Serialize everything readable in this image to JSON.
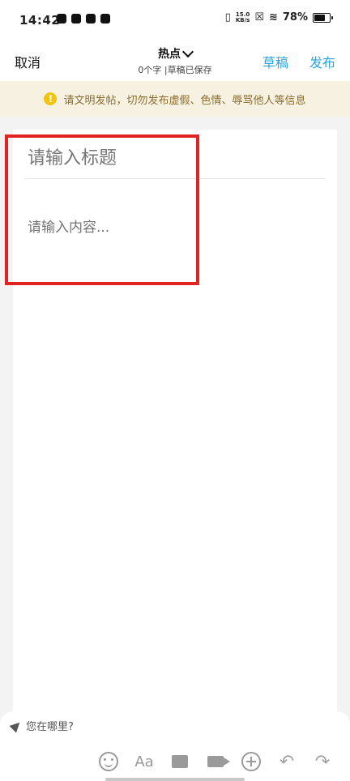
{
  "status_bar": {
    "time": "14:42",
    "net_speed_value": "15.0",
    "net_speed_unit": "KB/s",
    "battery": "78%"
  },
  "header": {
    "cancel_label": "取消",
    "category": "热点",
    "meta": "0个字 |草稿已保存",
    "drafts_label": "草稿",
    "publish_label": "发布"
  },
  "notice": {
    "text": "请文明发帖，切勿发布虚假、色情、辱骂他人等信息",
    "icon_glyph": "!"
  },
  "editor": {
    "title_placeholder": "请输入标题",
    "content_placeholder": "请输入内容..."
  },
  "bottom": {
    "location_placeholder": "您在哪里?",
    "font_tool_label": "Aa",
    "undo_glyph": "↶",
    "redo_glyph": "↷"
  },
  "colors": {
    "accent": "#2aa3d6",
    "notice_bg": "#f7f1e2",
    "highlight": "#e02424"
  }
}
